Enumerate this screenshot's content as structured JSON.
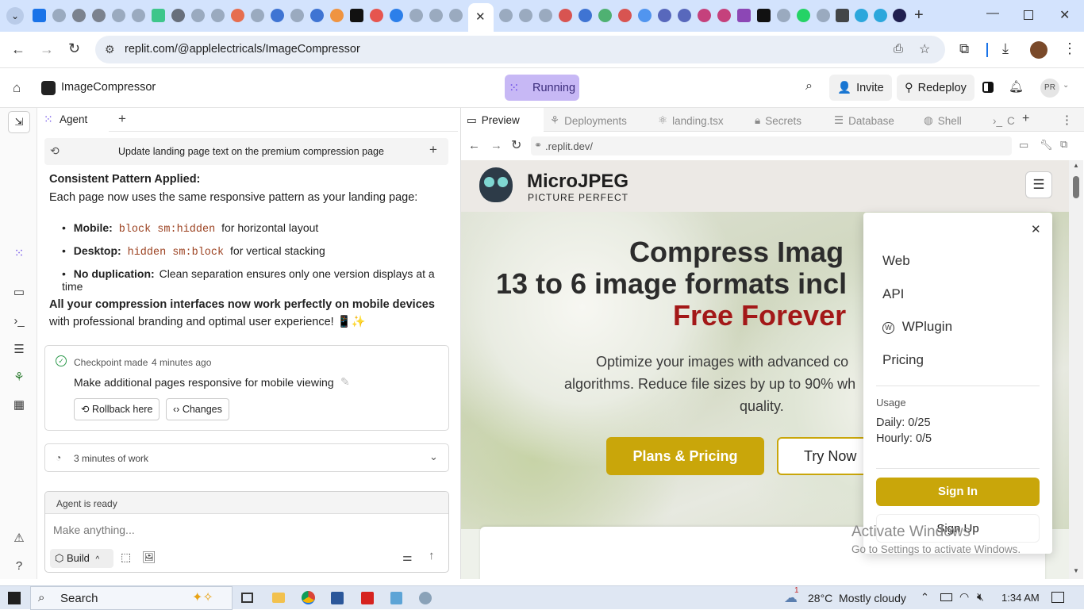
{
  "browser": {
    "url": "replit.com/@applelectricals/ImageCompressor",
    "window_controls": [
      "minimize",
      "maximize",
      "close"
    ]
  },
  "app": {
    "project_name": "ImageCompressor",
    "status": "Running",
    "invite_label": "Invite",
    "redeploy_label": "Redeploy",
    "avatar_initials": "PR"
  },
  "agent": {
    "tab_label": "Agent",
    "thread_title": "Update landing page text on the premium compression page",
    "heading": "Consistent Pattern Applied:",
    "intro": "Each page now uses the same responsive pattern as your landing page:",
    "bullets": [
      {
        "label": "Mobile:",
        "code": "block sm:hidden",
        "text": "for horizontal layout"
      },
      {
        "label": "Desktop:",
        "code": "hidden sm:block",
        "text": "for vertical stacking"
      },
      {
        "label": "No duplication:",
        "code": "",
        "text": "Clean separation ensures only one version displays at a time"
      }
    ],
    "summary_bold": "All your compression interfaces now work perfectly on mobile devices",
    "summary_rest": " with professional branding and optimal user experience! 📱✨",
    "checkpoint": {
      "label": "Checkpoint made",
      "time": "4 minutes ago",
      "message": "Make additional pages responsive for mobile viewing",
      "rollback_label": "Rollback here",
      "changes_label": "Changes"
    },
    "work_summary": "3 minutes of work",
    "ready_text": "Agent is ready",
    "input_placeholder": "Make anything...",
    "build_label": "Build"
  },
  "preview": {
    "tabs": [
      "Preview",
      "Deployments",
      "landing.tsx",
      "Secrets",
      "Database",
      "Shell",
      "C"
    ],
    "url": ".replit.dev/",
    "site": {
      "brand": "MicroJPEG",
      "tagline": "PICTURE PERFECT",
      "hero_line1": "Compress Imag",
      "hero_line2": "13 to 6 image formats incl",
      "hero_line3": "Free Forever",
      "hero_desc_1": "Optimize your images with advanced co",
      "hero_desc_2": "algorithms. Reduce file sizes by up to 90% wh",
      "hero_desc_3": "quality.",
      "btn_primary": "Plans & Pricing",
      "btn_secondary": "Try Now"
    },
    "menu": {
      "items": [
        "Web",
        "API",
        "WPlugin",
        "Pricing"
      ],
      "usage_label": "Usage",
      "daily": "Daily: 0/25",
      "hourly": "Hourly: 0/5",
      "sign_in": "Sign In",
      "sign_up": "Sign Up"
    },
    "watermark_title": "Activate Windows",
    "watermark_sub": "Go to Settings to activate Windows."
  },
  "taskbar": {
    "search_label": "Search",
    "notification_count": "1",
    "weather": "28°C  Mostly cloudy",
    "time": "1:34 AM"
  },
  "colors": {
    "accent_gold": "#c9a60a",
    "hero_red": "#a31818",
    "running_bg": "#c7b8f5"
  }
}
